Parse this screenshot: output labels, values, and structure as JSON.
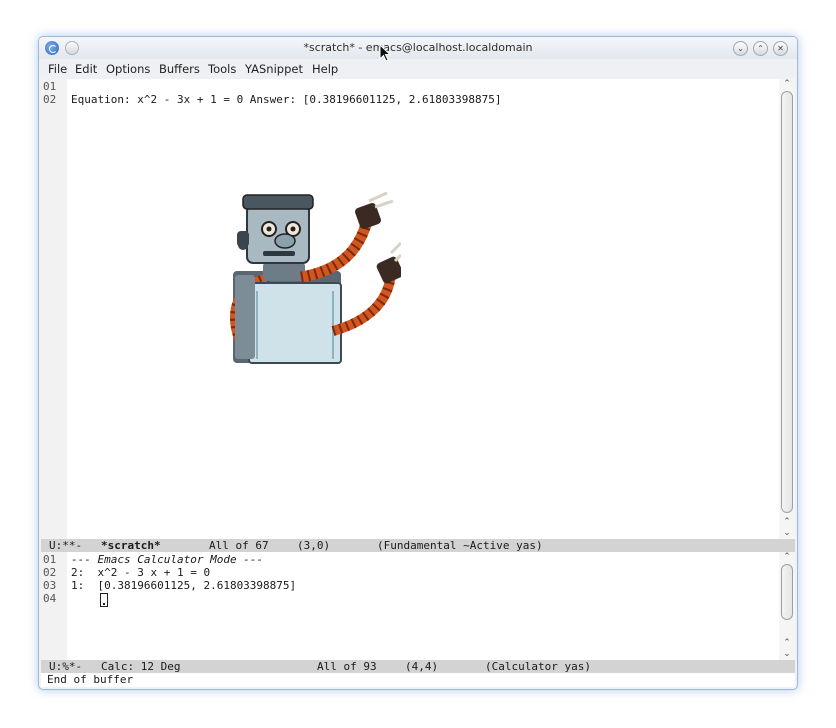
{
  "window": {
    "title": "*scratch* - emacs@localhost.localdomain"
  },
  "menubar": {
    "items": [
      "File",
      "Edit",
      "Options",
      "Buffers",
      "Tools",
      "YASnippet",
      "Help"
    ]
  },
  "top_buffer": {
    "lines": [
      {
        "num": "01",
        "text": ""
      },
      {
        "num": "02",
        "text": "Equation: x^2 - 3x + 1 = 0 Answer: [0.38196601125, 2.61803398875]"
      }
    ],
    "image_label": "robot-illustration"
  },
  "top_modeline": {
    "status": "U:**-",
    "buffer_name": "*scratch*",
    "position": "All of 67",
    "cursor": "(3,0)",
    "modes": "(Fundamental ~Active yas)"
  },
  "calc_buffer": {
    "lines": [
      {
        "num": "01",
        "text": "--- Emacs Calculator Mode ---"
      },
      {
        "num": "02",
        "text": "2:  x^2 - 3 x + 1 = 0"
      },
      {
        "num": "03",
        "text": "1:  [0.38196601125, 2.61803398875]"
      },
      {
        "num": "04",
        "text": ""
      }
    ]
  },
  "calc_modeline": {
    "status": "U:%*-",
    "buffer_name": "Calc: 12 Deg",
    "position": "All of 93",
    "cursor": "(4,4)",
    "modes": "(Calculator yas)"
  },
  "echo_area": {
    "message": "End of buffer"
  },
  "colors": {
    "modeline_bg": "#d3d3d3",
    "gutter_bg": "#f2f2f2",
    "window_glow": "#6ea0dc"
  }
}
